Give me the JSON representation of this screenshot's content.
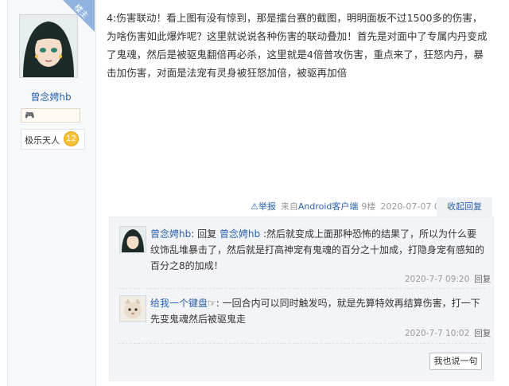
{
  "author": {
    "badge": "楼主",
    "name": "曾念娉hb",
    "medal_icon": "gamepad-medal-icon",
    "rank_label": "极乐天人",
    "rank_level": "12"
  },
  "post": {
    "content": "4:伤害联动！看上图有没有惊到，那是擂台赛的截图，明明面板不过1500多的伤害，为啥伤害如此爆炸呢？这里就说说各种伤害的联动叠加！首先是对面中了专属内丹变成了鬼魂，然后是被驱鬼翻倍再必杀，这里就是4倍普攻伤害，重点来了，狂怒内丹，暴击加伤害，对面是法宠有灵身被狂怒加倍，被驱再加倍",
    "tail": {
      "report_icon": "warning-triangle-icon",
      "report_label": "举报",
      "source_prefix": "来自",
      "source_app": "Android客户端",
      "floor": "9楼",
      "time": "2020-07-07 09:20"
    },
    "collapse_label": "收起回复"
  },
  "replies": [
    {
      "author": "曾念娉hb",
      "colon": ":",
      "action": " 回复 ",
      "target": "曾念娉hb",
      "text": " :然后就变成上面那种恐怖的结果了，所以为什么要纹饰乱堆暴击了，然后就是打高神宠有鬼魂的百分之十加成，打隐身宠有感知的百分之8的加成！",
      "time": "2020-7-7 09:20",
      "reply_label": "回复"
    },
    {
      "author": "给我一个键盘",
      "emoji": "☞",
      "colon": ":",
      "text": " 一回合内可以同时触发吗，就是先算特效再结算伤害，打一下先变鬼魂然后被驱鬼走",
      "time": "2020-7-7 10:02",
      "reply_label": "回复"
    }
  ],
  "say_label": "我也说一句",
  "colors": {
    "link": "#2a62b0",
    "meta": "#999999",
    "badge": "#8fb3de"
  }
}
